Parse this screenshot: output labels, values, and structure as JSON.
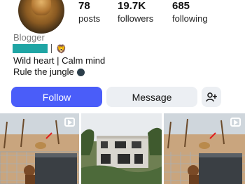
{
  "profile": {
    "stats": [
      {
        "value": "78",
        "label": "posts"
      },
      {
        "value": "19.7K",
        "label": "followers"
      },
      {
        "value": "685",
        "label": "following"
      }
    ],
    "category": "Blogger",
    "name_emoji": "🦁",
    "bio_line1": "Wild heart | Calm mind",
    "bio_line2": "Rule the jungle"
  },
  "actions": {
    "follow_label": "Follow",
    "message_label": "Message"
  },
  "colors": {
    "follow_button": "#4a5df9",
    "secondary_button": "#eceff3",
    "redacted_name": "#1fa5a4"
  },
  "icons": {
    "add_person": "person-plus-icon",
    "reel": "reel-play-icon",
    "moon": "dark-moon-icon"
  },
  "grid": [
    {
      "type": "reel",
      "subject": "lion behind fence"
    },
    {
      "type": "photo",
      "subject": "abandoned house"
    },
    {
      "type": "reel",
      "subject": "lion behind fence"
    }
  ]
}
